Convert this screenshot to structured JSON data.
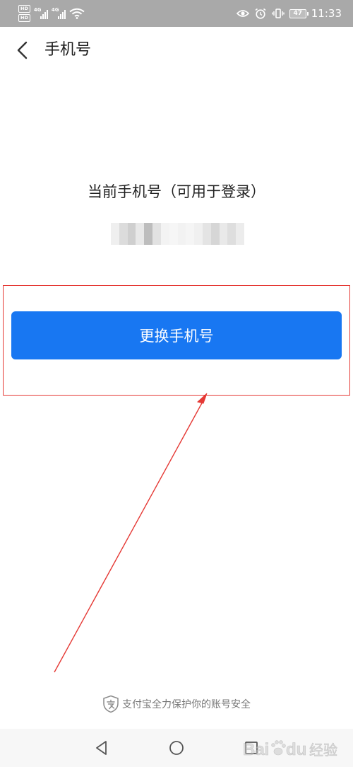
{
  "status_bar": {
    "hd_badges": [
      "HD",
      "HD"
    ],
    "network_labels": [
      "4G",
      "4G"
    ],
    "battery_level": "47",
    "time": "11:33",
    "icons": [
      "hd-icon",
      "signal-icon",
      "wifi-icon",
      "eye-icon",
      "alarm-icon",
      "vibrate-icon",
      "battery-icon"
    ]
  },
  "header": {
    "title": "手机号",
    "back_icon": "chevron-left-icon"
  },
  "main": {
    "heading": "当前手机号（可用于登录）",
    "masked_number_state": "pixelated / obscured"
  },
  "action": {
    "change_button_label": "更换手机号"
  },
  "footer": {
    "security_text": "支付宝全力保护你的账号安全",
    "shield_icon": "alipay-shield-icon"
  },
  "nav_bar": {
    "icons": [
      "back-triangle-icon",
      "home-circle-icon",
      "recent-square-icon"
    ]
  },
  "watermark": {
    "text": "Bai du 经验"
  },
  "colors": {
    "status_bar": "#a9a9a9",
    "primary_button": "#1877f2",
    "annotation_red": "#e53935",
    "footer_text": "#777777",
    "nav_bar": "#f7f7f7"
  }
}
